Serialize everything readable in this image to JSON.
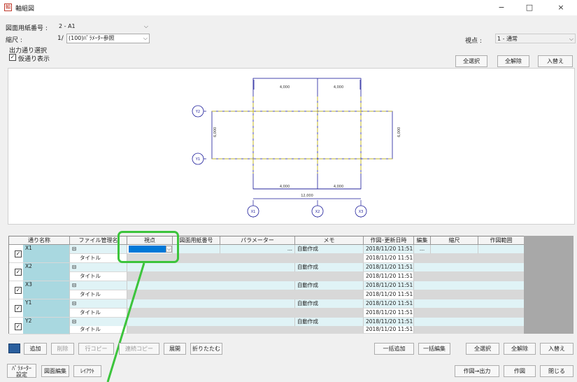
{
  "window": {
    "title": "軸組図",
    "minimize": "−",
    "maximize": "□",
    "close": "×"
  },
  "form": {
    "drawing_label": "図面用紙番号 :",
    "drawing_value": "2 - A1",
    "scale_label": "縮尺 :",
    "scale_prefix": "1/",
    "scale_value": "(100)ﾊﾟﾗﾒｰﾀｰ参照",
    "section_label": "出力通り選択",
    "temp_display_label": "仮通り表示",
    "viewpoint_label": "視点 :",
    "viewpoint_value": "1 - 通常"
  },
  "top_buttons": {
    "select_all": "全選択",
    "deselect_all": "全解除",
    "swap": "入替え"
  },
  "preview": {
    "dims": [
      "4,000",
      "4,000",
      "6,000",
      "6,000",
      "4,000",
      "4,000",
      "12,000"
    ],
    "axis_labels": [
      "Y2",
      "Y1",
      "X1",
      "X2",
      "X3"
    ]
  },
  "grid": {
    "headers": [
      "通り名称",
      "ファイル管理名",
      "視点",
      "図面用紙番号",
      "パラメーター",
      "メモ",
      "作図･更新日時",
      "編集",
      "縮尺",
      "作図範囲"
    ],
    "rows": [
      {
        "name": "X1",
        "memo": "自動作成",
        "date1": "2018/11/20 11:51",
        "date2": "2018/11/20 11:51",
        "title": "タイトル"
      },
      {
        "name": "X2",
        "memo": "自動作成",
        "date1": "2018/11/20 11:51",
        "date2": "2018/11/20 11:51",
        "title": "タイトル"
      },
      {
        "name": "X3",
        "memo": "自動作成",
        "date1": "2018/11/20 11:51",
        "date2": "2018/11/20 11:51",
        "title": "タイトル"
      },
      {
        "name": "Y1",
        "memo": "自動作成",
        "date1": "2018/11/20 11:51",
        "date2": "2018/11/20 11:51",
        "title": "タイトル"
      },
      {
        "name": "Y2",
        "memo": "自動作成",
        "date1": "2018/11/20 11:51",
        "date2": "2018/11/20 11:51",
        "title": "タイトル"
      }
    ],
    "tree_marker": "⊟",
    "edit_marker": "..."
  },
  "bottom_buttons": {
    "add": "追加",
    "delete": "削除",
    "row_copy": "行コピー",
    "multi_copy": "連続コピー",
    "expand": "展開",
    "collapse": "折りたたむ",
    "bulk_add": "一括追加",
    "bulk_edit": "一括編集",
    "select_all": "全選択",
    "deselect_all": "全解除",
    "swap": "入替え"
  },
  "footer_buttons": {
    "param_line1": "ﾊﾟﾗﾒｰﾀｰ",
    "param_line2": "設定",
    "drawing_edit": "図面編集",
    "layout": "ﾚｲｱｳﾄ",
    "draw_output": "作図→出力",
    "draw": "作図",
    "close": "閉じる"
  },
  "colors": {
    "highlight": "#3cc43c",
    "selected_cell": "#0078d7",
    "row_tint": "#e0f3f6",
    "name_cell": "#a9d8e0"
  }
}
